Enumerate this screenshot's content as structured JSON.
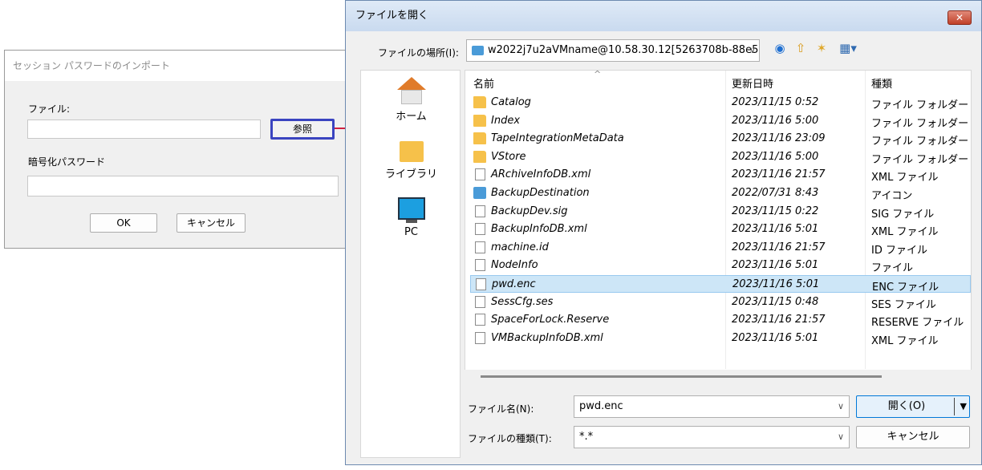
{
  "import_dialog": {
    "title": "セッション パスワードのインポート",
    "file_label": "ファイル:",
    "file_value": "",
    "browse_label": "参照",
    "password_label": "暗号化パスワード",
    "password_value": "",
    "ok_label": "OK",
    "cancel_label": "キャンセル"
  },
  "open_dialog": {
    "title": "ファイルを開く",
    "close_glyph": "✕",
    "location_label": "ファイルの場所(I):",
    "location_value": "w2022j7u2aVMname@10.58.30.12[5263708b-88e5",
    "places": [
      "ホーム",
      "ライブラリ",
      "PC"
    ],
    "columns": {
      "name": "名前",
      "modified": "更新日時",
      "type": "種類"
    },
    "files": [
      {
        "name": "Catalog",
        "date": "2023/11/15 0:52",
        "type": "ファイル フォルダー",
        "icon": "folder-icon"
      },
      {
        "name": "Index",
        "date": "2023/11/16 5:00",
        "type": "ファイル フォルダー",
        "icon": "folder-icon"
      },
      {
        "name": "TapeIntegrationMetaData",
        "date": "2023/11/16 23:09",
        "type": "ファイル フォルダー",
        "icon": "folder-icon"
      },
      {
        "name": "VStore",
        "date": "2023/11/16 5:00",
        "type": "ファイル フォルダー",
        "icon": "folder-icon"
      },
      {
        "name": "ARchiveInfoDB.xml",
        "date": "2023/11/16 21:57",
        "type": "XML ファイル",
        "icon": "file-icon"
      },
      {
        "name": "BackupDestination",
        "date": "2022/07/31 8:43",
        "type": "アイコン",
        "icon": "system-folder-icon"
      },
      {
        "name": "BackupDev.sig",
        "date": "2023/11/15 0:22",
        "type": "SIG ファイル",
        "icon": "file-icon"
      },
      {
        "name": "BackupInfoDB.xml",
        "date": "2023/11/16 5:01",
        "type": "XML ファイル",
        "icon": "file-icon"
      },
      {
        "name": "machine.id",
        "date": "2023/11/16 21:57",
        "type": "ID ファイル",
        "icon": "file-icon"
      },
      {
        "name": "NodeInfo",
        "date": "2023/11/16 5:01",
        "type": "ファイル",
        "icon": "file-icon"
      },
      {
        "name": "pwd.enc",
        "date": "2023/11/16 5:01",
        "type": "ENC ファイル",
        "icon": "file-icon",
        "selected": true
      },
      {
        "name": "SessCfg.ses",
        "date": "2023/11/15 0:48",
        "type": "SES ファイル",
        "icon": "file-icon"
      },
      {
        "name": "SpaceForLock.Reserve",
        "date": "2023/11/16 21:57",
        "type": "RESERVE ファイル",
        "icon": "file-icon"
      },
      {
        "name": "VMBackupInfoDB.xml",
        "date": "2023/11/16 5:01",
        "type": "XML ファイル",
        "icon": "file-icon"
      }
    ],
    "filename_label": "ファイル名(N):",
    "filename_value": "pwd.enc",
    "filetype_label": "ファイルの種類(T):",
    "filetype_value": "*.*",
    "open_label": "開く(O)",
    "cancel_label": "キャンセル"
  }
}
